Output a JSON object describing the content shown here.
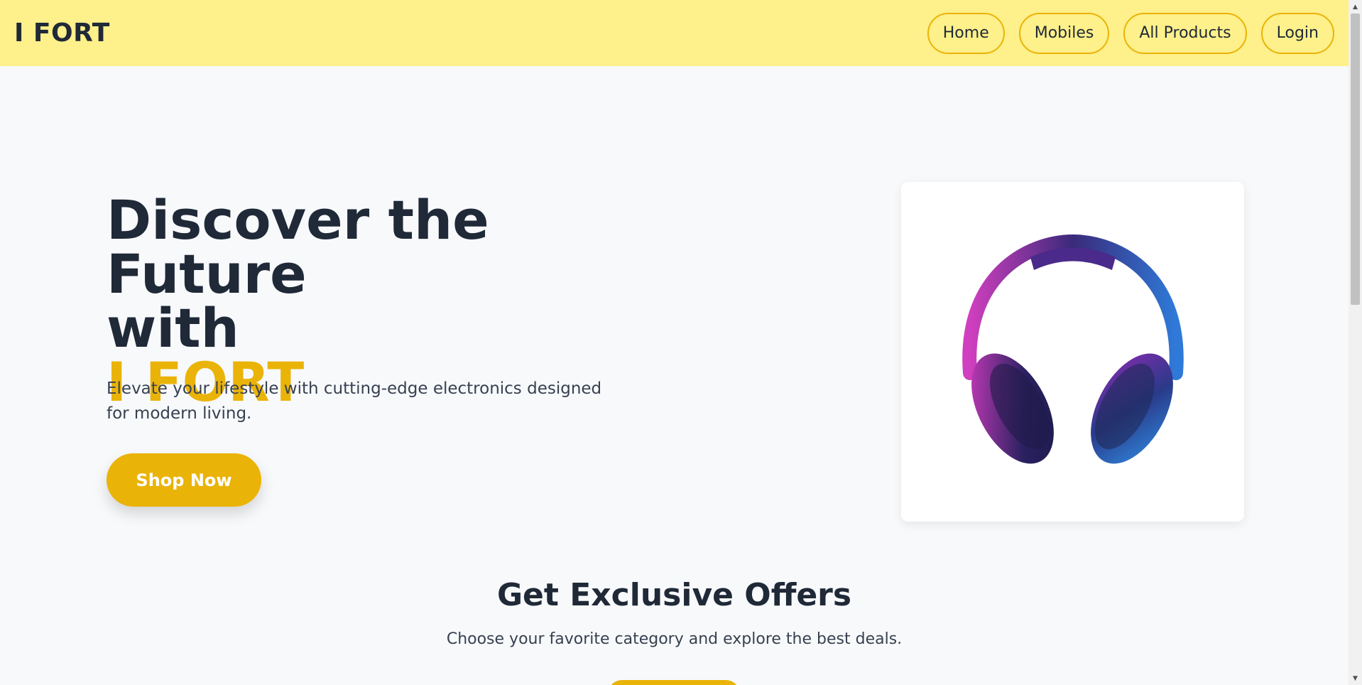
{
  "header": {
    "brand": "I FORT",
    "nav": [
      "Home",
      "Mobiles",
      "All Products",
      "Login"
    ]
  },
  "hero": {
    "title_line1": "Discover the Future",
    "title_line2": "with",
    "title_brand": "I FORT",
    "subtitle": "Elevate your lifestyle with cutting-edge electronics designed for modern living.",
    "cta": "Shop Now",
    "product_image": "headphones-image"
  },
  "offers": {
    "title": "Get Exclusive Offers",
    "subtitle": "Choose your favorite category and explore the best deals."
  },
  "colors": {
    "header_bg": "#fef08a",
    "accent": "#eab308",
    "text_dark": "#1f2937",
    "page_bg": "#f8f9fb"
  }
}
